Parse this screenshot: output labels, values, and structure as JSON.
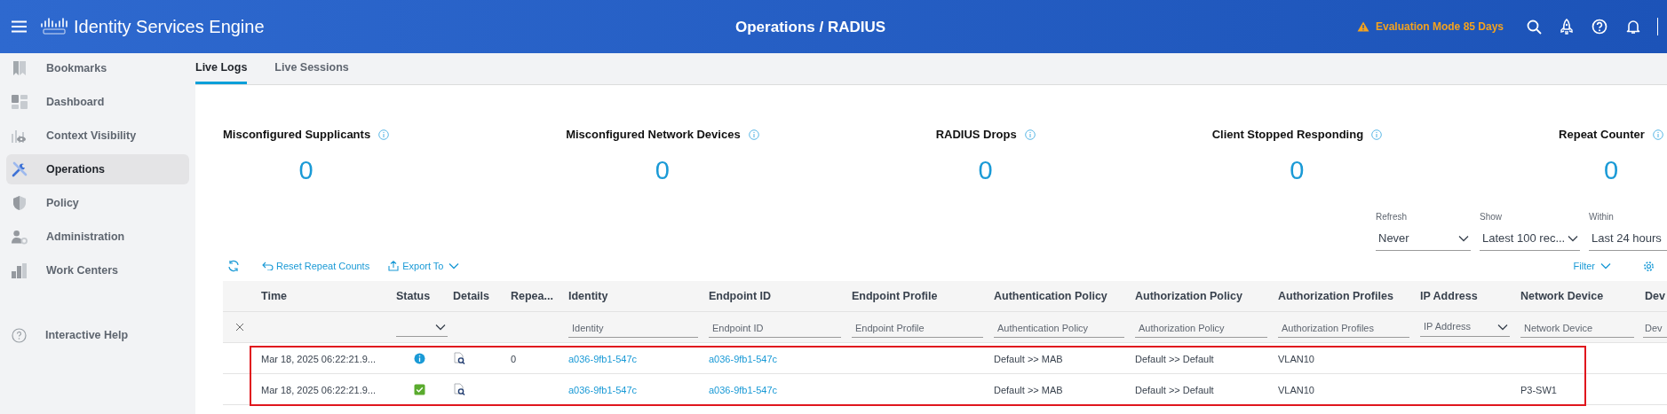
{
  "header": {
    "title": "Identity Services Engine",
    "page_title": "Operations / RADIUS",
    "evaluation_notice": "Evaluation Mode 85 Days"
  },
  "sidebar": {
    "items": [
      {
        "label": "Bookmarks",
        "selected": false
      },
      {
        "label": "Dashboard",
        "selected": false
      },
      {
        "label": "Context Visibility",
        "selected": false
      },
      {
        "label": "Operations",
        "selected": true
      },
      {
        "label": "Policy",
        "selected": false
      },
      {
        "label": "Administration",
        "selected": false
      },
      {
        "label": "Work Centers",
        "selected": false
      }
    ],
    "help": "Interactive Help"
  },
  "tabs": [
    {
      "label": "Live Logs",
      "selected": true
    },
    {
      "label": "Live Sessions",
      "selected": false
    }
  ],
  "metrics": [
    {
      "label": "Misconfigured Supplicants",
      "value": "0"
    },
    {
      "label": "Misconfigured Network Devices",
      "value": "0"
    },
    {
      "label": "RADIUS Drops",
      "value": "0"
    },
    {
      "label": "Client Stopped Responding",
      "value": "0"
    },
    {
      "label": "Repeat Counter",
      "value": "0"
    }
  ],
  "controls": [
    {
      "label": "Refresh",
      "value": "Never"
    },
    {
      "label": "Show",
      "value": "Latest 100 rec..."
    },
    {
      "label": "Within",
      "value": "Last 24 hours"
    }
  ],
  "toolbar": {
    "reset": "Reset Repeat Counts",
    "export": "Export To",
    "filter": "Filter"
  },
  "table": {
    "columns": [
      {
        "label": "Time"
      },
      {
        "label": "Status",
        "filter": {
          "kind": "select"
        }
      },
      {
        "label": "Details"
      },
      {
        "label": "Repea..."
      },
      {
        "label": "Identity",
        "filter": {
          "kind": "text",
          "placeholder": "Identity"
        }
      },
      {
        "label": "Endpoint ID",
        "filter": {
          "kind": "text",
          "placeholder": "Endpoint ID"
        }
      },
      {
        "label": "Endpoint Profile",
        "filter": {
          "kind": "text",
          "placeholder": "Endpoint Profile"
        }
      },
      {
        "label": "Authentication Policy",
        "filter": {
          "kind": "text",
          "placeholder": "Authentication Policy"
        }
      },
      {
        "label": "Authorization Policy",
        "filter": {
          "kind": "text",
          "placeholder": "Authorization Policy"
        }
      },
      {
        "label": "Authorization Profiles",
        "filter": {
          "kind": "text",
          "placeholder": "Authorization Profiles"
        }
      },
      {
        "label": "IP Address",
        "filter": {
          "kind": "select",
          "placeholder": "IP Address"
        }
      },
      {
        "label": "Network Device",
        "filter": {
          "kind": "text",
          "placeholder": "Network Device"
        }
      },
      {
        "label": "Dev",
        "filter": {
          "kind": "text",
          "placeholder": "Dev"
        }
      }
    ],
    "rows_highlighted": true,
    "rows": [
      {
        "time": "Mar 18, 2025 06:22:21.9...",
        "status": {
          "kind": "info"
        },
        "repeat_count": "0",
        "identity": "a036-9fb1-547c",
        "endpoint_id": "a036-9fb1-547c",
        "authentication_policy": "Default >> MAB",
        "authorization_policy": "Default >> Default",
        "authorization_profiles": "VLAN10"
      },
      {
        "time": "Mar 18, 2025 06:22:21.9...",
        "status": {
          "kind": "success"
        },
        "identity": "a036-9fb1-547c",
        "endpoint_id": "a036-9fb1-547c",
        "authentication_policy": "Default >> MAB",
        "authorization_policy": "Default >> Default",
        "authorization_profiles": "VLAN10",
        "network_device": "P3-SW1"
      }
    ]
  }
}
